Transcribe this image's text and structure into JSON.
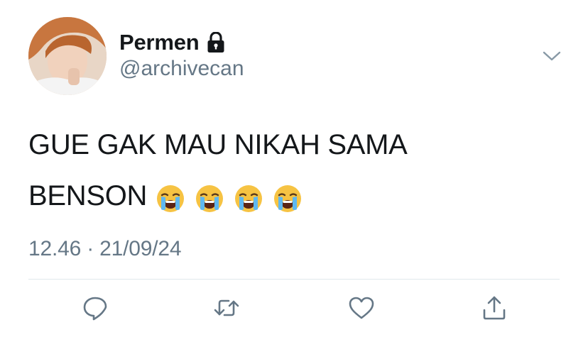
{
  "user": {
    "display_name": "Permen",
    "handle": "@archivecan",
    "protected": true
  },
  "icons": {
    "lock": "lock-icon",
    "menu": "chevron-down-icon",
    "emoji": "loudly-crying-face-emoji",
    "reply": "reply-icon",
    "retweet": "retweet-icon",
    "like": "heart-icon",
    "share": "share-icon"
  },
  "tweet": {
    "text": "GUE GAK MAU NIKAH SAMA\nBENSON",
    "emoji": [
      "😭",
      "😭",
      "😭",
      "😭"
    ],
    "timestamp": "12.46 · 21/09/24"
  },
  "colors": {
    "text": "#14171a",
    "secondary": "#657786",
    "divider": "#e1e8ed",
    "icon": "#657786"
  }
}
